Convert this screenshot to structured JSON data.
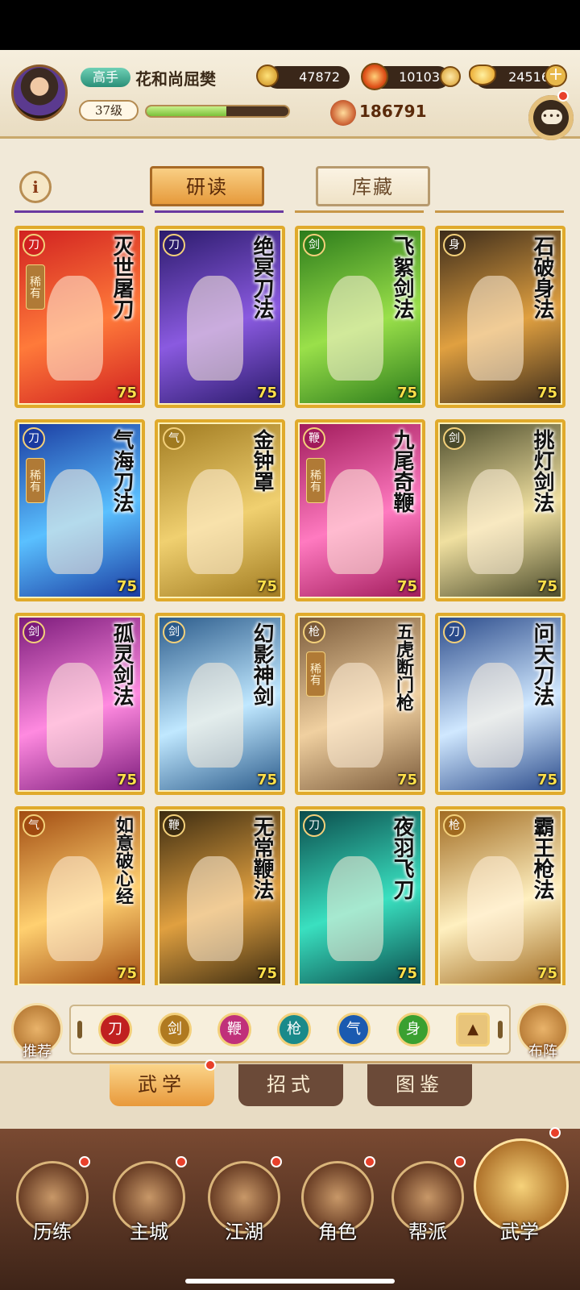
{
  "header": {
    "rank_badge": "高手",
    "player_name": "花和尚屈樊",
    "level": "37级",
    "exp_progress": 0.56,
    "power": "186791",
    "currencies": [
      {
        "icon": "copper-coin-icon",
        "value": "47872"
      },
      {
        "icon": "flame-gem-icon",
        "value": "10103"
      },
      {
        "icon": "gold-ingot-icon",
        "value": "24516"
      }
    ]
  },
  "tabs": {
    "study": "研读",
    "storage": "库藏",
    "active": "研读"
  },
  "cards": [
    {
      "title": "灭世屠刀",
      "type": "blade-icon",
      "rare": true,
      "level": "75",
      "bg": [
        "#d02020",
        "#ff7a3a"
      ],
      "glyph": "刀"
    },
    {
      "title": "绝冥刀法",
      "type": "blade-icon",
      "rare": false,
      "level": "75",
      "bg": [
        "#2a1a6a",
        "#8a5ae0"
      ],
      "glyph": "刀"
    },
    {
      "title": "飞絮剑法",
      "type": "sword-icon",
      "rare": false,
      "level": "75",
      "bg": [
        "#2a7a1a",
        "#9ae04a"
      ],
      "glyph": "剑"
    },
    {
      "title": "石破身法",
      "type": "movement-icon",
      "rare": false,
      "level": "75",
      "bg": [
        "#3a2a1a",
        "#e0a040"
      ],
      "glyph": "身"
    },
    {
      "title": "气海刀法",
      "type": "blade-icon",
      "rare": true,
      "level": "75",
      "bg": [
        "#1a3aa0",
        "#5ac0ff"
      ],
      "glyph": "刀"
    },
    {
      "title": "金钟罩",
      "type": "internal-icon",
      "rare": false,
      "level": "75",
      "bg": [
        "#a07a20",
        "#f0d070"
      ],
      "glyph": "气"
    },
    {
      "title": "九尾奇鞭",
      "type": "whip-icon",
      "rare": true,
      "level": "75",
      "bg": [
        "#a01a5a",
        "#ff7ac0"
      ],
      "glyph": "鞭"
    },
    {
      "title": "挑灯剑法",
      "type": "sword-icon",
      "rare": false,
      "level": "75",
      "bg": [
        "#4a4a2a",
        "#f0e0a0"
      ],
      "glyph": "剑"
    },
    {
      "title": "孤灵剑法",
      "type": "sword-icon",
      "rare": false,
      "level": "75",
      "bg": [
        "#7a1a7a",
        "#ff8ae0"
      ],
      "glyph": "剑"
    },
    {
      "title": "幻影神剑",
      "type": "sword-icon",
      "rare": false,
      "level": "75",
      "bg": [
        "#2a5a8a",
        "#c0e8ff"
      ],
      "glyph": "剑"
    },
    {
      "title": "五虎断门枪",
      "type": "spear-icon",
      "rare": true,
      "level": "75",
      "bg": [
        "#7a5a3a",
        "#f0d0a0"
      ],
      "glyph": "枪"
    },
    {
      "title": "问天刀法",
      "type": "blade-icon",
      "rare": false,
      "level": "75",
      "bg": [
        "#2a4a8a",
        "#d0e8ff"
      ],
      "glyph": "刀"
    },
    {
      "title": "如意破心经",
      "type": "internal-icon",
      "rare": false,
      "level": "75",
      "bg": [
        "#a04a10",
        "#ffd070"
      ],
      "glyph": "气"
    },
    {
      "title": "无常鞭法",
      "type": "whip-icon",
      "rare": false,
      "level": "75",
      "bg": [
        "#3a2a10",
        "#e0a040"
      ],
      "glyph": "鞭"
    },
    {
      "title": "夜羽飞刀",
      "type": "blade-icon",
      "rare": false,
      "level": "75",
      "bg": [
        "#0a4a4a",
        "#3ae0c0"
      ],
      "glyph": "刀"
    },
    {
      "title": "霸王枪法",
      "type": "spear-icon",
      "rare": false,
      "level": "75",
      "bg": [
        "#a06a20",
        "#fff0c0"
      ],
      "glyph": "枪"
    }
  ],
  "rare_label": "稀有",
  "filters": [
    {
      "name": "blade-filter-icon",
      "color": "#c02020",
      "glyph": "刀"
    },
    {
      "name": "sword-filter-icon",
      "color": "#b07a20",
      "glyph": "剑"
    },
    {
      "name": "whip-filter-icon",
      "color": "#c0307a",
      "glyph": "鞭"
    },
    {
      "name": "spear-filter-icon",
      "color": "#1a8a8a",
      "glyph": "枪"
    },
    {
      "name": "internal-filter-icon",
      "color": "#1a5ab0",
      "glyph": "气"
    },
    {
      "name": "movement-filter-icon",
      "color": "#3aa030",
      "glyph": "身"
    },
    {
      "name": "all-filter-icon",
      "color": "#e8c47a",
      "glyph": "▲"
    }
  ],
  "left_button": "推荐",
  "right_button": "布阵",
  "subtabs": {
    "martial": "武学",
    "moves": "招式",
    "codex": "图鉴"
  },
  "nav": [
    {
      "label": "历练",
      "icon": "training-icon"
    },
    {
      "label": "主城",
      "icon": "city-icon"
    },
    {
      "label": "江湖",
      "icon": "jianghu-icon"
    },
    {
      "label": "角色",
      "icon": "character-icon"
    },
    {
      "label": "帮派",
      "icon": "guild-icon"
    },
    {
      "label": "武学",
      "icon": "martial-scroll-icon"
    }
  ],
  "colors": {
    "accent": "#e69a3b",
    "badge": "#e8402b",
    "card_border": "#e0aa2b",
    "level_text": "#ffe04a"
  }
}
